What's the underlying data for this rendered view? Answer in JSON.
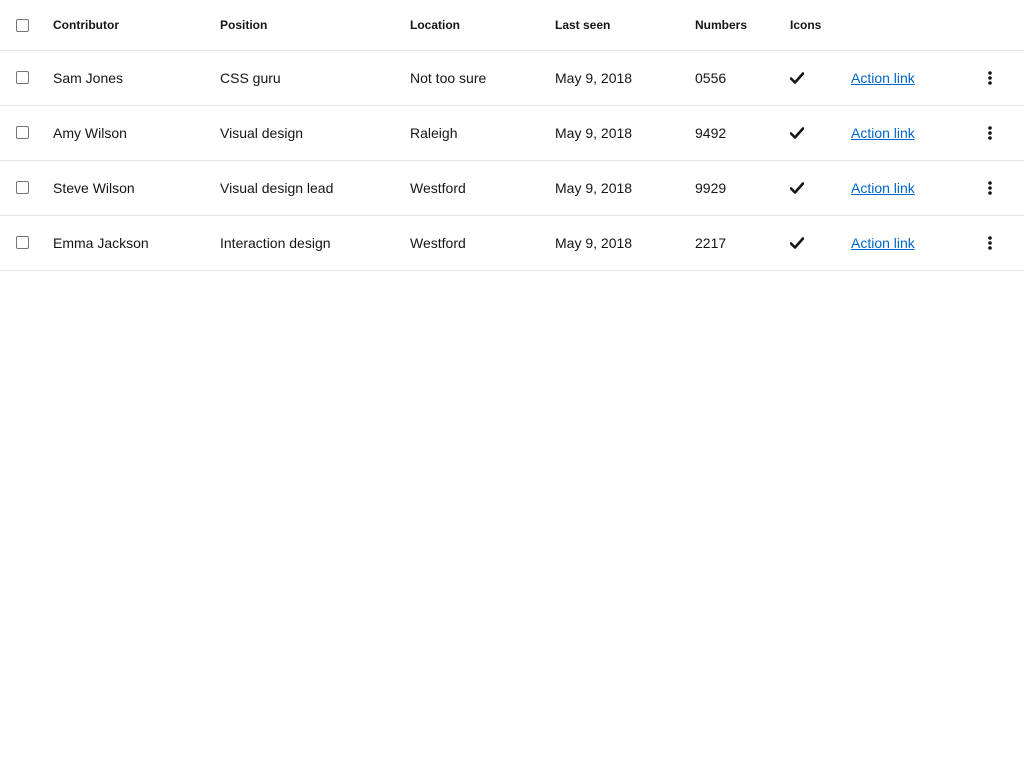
{
  "table": {
    "headers": {
      "contributor": "Contributor",
      "position": "Position",
      "location": "Location",
      "last_seen": "Last seen",
      "numbers": "Numbers",
      "icons": "Icons"
    },
    "rows": [
      {
        "contributor": "Sam Jones",
        "position": "CSS guru",
        "location": "Not too sure",
        "last_seen": "May 9, 2018",
        "number": "0556",
        "icon": "check-icon",
        "action": "Action link"
      },
      {
        "contributor": "Amy Wilson",
        "position": "Visual design",
        "location": "Raleigh",
        "last_seen": "May 9, 2018",
        "number": "9492",
        "icon": "check-icon",
        "action": "Action link"
      },
      {
        "contributor": "Steve Wilson",
        "position": "Visual design lead",
        "location": "Westford",
        "last_seen": "May 9, 2018",
        "number": "9929",
        "icon": "check-icon",
        "action": "Action link"
      },
      {
        "contributor": "Emma Jackson",
        "position": "Interaction design",
        "location": "Westford",
        "last_seen": "May 9, 2018",
        "number": "2217",
        "icon": "check-icon",
        "action": "Action link"
      }
    ]
  },
  "colors": {
    "link": "#0066cc",
    "text": "#151515"
  }
}
